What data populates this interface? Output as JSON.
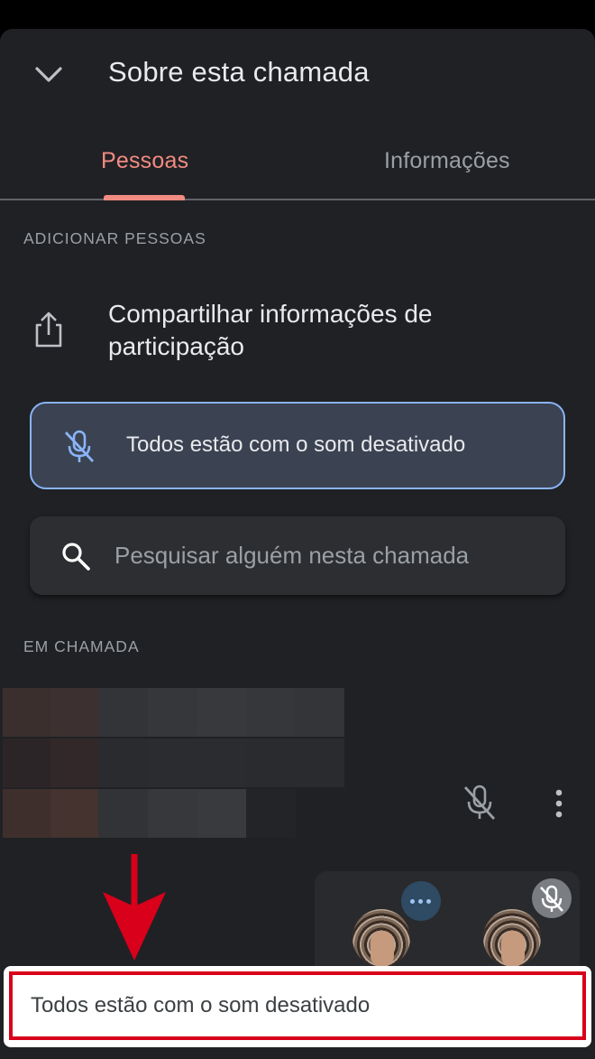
{
  "header": {
    "title": "Sobre esta chamada",
    "collapse_icon": "chevron-down-icon"
  },
  "tabs": [
    {
      "label": "Pessoas",
      "active": true
    },
    {
      "label": "Informações",
      "active": false
    }
  ],
  "add_people": {
    "section_label": "ADICIONAR PESSOAS",
    "share_label": "Compartilhar informações de participação",
    "share_icon": "share-icon"
  },
  "mute_banner": {
    "text": "Todos estão com o som desativado",
    "icon": "mic-off-icon"
  },
  "search": {
    "placeholder": "Pesquisar alguém nesta chamada",
    "icon": "search-icon"
  },
  "in_call": {
    "section_label": "EM CHAMADA",
    "participant": {
      "name_redacted": true,
      "mic_icon": "mic-off-icon",
      "more_icon": "more-vert-icon"
    }
  },
  "pip": {
    "more_icon": "more-horiz-icon",
    "mute_icon": "mic-off-icon"
  },
  "toast": {
    "text": "Todos estão com o som desativado"
  },
  "annotation": {
    "arrow_color": "#d8001b",
    "outline_color": "#d8001b"
  },
  "colors": {
    "accent": "#f28b82",
    "banner_border": "#8ab4f8",
    "background": "#202124"
  }
}
